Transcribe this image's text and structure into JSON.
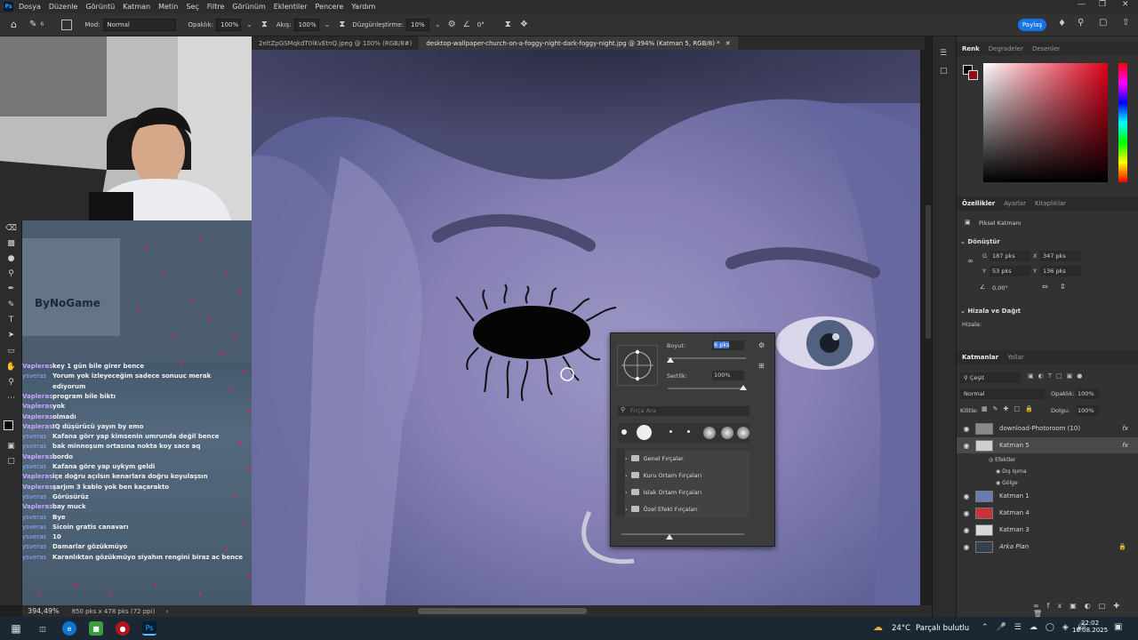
{
  "menu": {
    "app_logo": "Ps",
    "items": [
      "Dosya",
      "Düzenle",
      "Görüntü",
      "Katman",
      "Metin",
      "Seç",
      "Filtre",
      "Görünüm",
      "Eklentiler",
      "Pencere",
      "Yardım"
    ]
  },
  "options_bar": {
    "brush_size": "6",
    "mode_label": "Mod:",
    "mode_value": "Normal",
    "opacity_label": "Opaklık:",
    "opacity_value": "100%",
    "flow_label": "Akış:",
    "flow_value": "100%",
    "smoothing_label": "Düzgünleştirme:",
    "smoothing_value": "10%",
    "angle_value": "0°",
    "share_label": "Paylaş"
  },
  "tabs": [
    {
      "label": "2eltZpGSMqkdT0lKvEtnQ.jpeg @ 100% (RGB/8#)"
    },
    {
      "label": "desktop-wallpaper-church-on-a-foggy-night-dark-foggy-night.jpg @ 394% (Katman 5, RGB/8) *"
    }
  ],
  "overlay": {
    "watermark": "ByNoGame"
  },
  "chat": [
    {
      "user": "Vaplerаs",
      "text": "key 1 gün bile girer bence",
      "v": true
    },
    {
      "user": "ysverаs",
      "text": "Yorum yok izleyeceğim sadece sonuuc merak",
      "v": false
    },
    {
      "user": "",
      "text": "ediyorum",
      "v": false
    },
    {
      "user": "Vaplerаs",
      "text": "program bile biktı",
      "v": true
    },
    {
      "user": "Vaplerаs",
      "text": "yok",
      "v": true
    },
    {
      "user": "Vaplerаs",
      "text": "olmadı",
      "v": true
    },
    {
      "user": "Vaplerаs",
      "text": "IQ düşürücü yayın by emo",
      "v": true
    },
    {
      "user": "ysverаs",
      "text": "Kafana görr yap kimsenin umrunda değil bence",
      "v": false
    },
    {
      "user": "ysverаs",
      "text": "bak minnoşum ortasına nokta koy sace aq",
      "v": false
    },
    {
      "user": "Vaplerаs",
      "text": "bordo",
      "v": true
    },
    {
      "user": "ysverаs",
      "text": "Kafana göre yap uykym geldi",
      "v": false
    },
    {
      "user": "Vaplerаs",
      "text": "içe doğru açılsın kenarlara doğru koyulaşsın",
      "v": true
    },
    {
      "user": "Vaplerаs",
      "text": "şarjım 3 kablo yok ben kaçarakto",
      "v": true
    },
    {
      "user": "ysverаs",
      "text": "Görüsürüz",
      "v": false
    },
    {
      "user": "Vaplerаs",
      "text": "bay muck",
      "v": true
    },
    {
      "user": "ysverаs",
      "text": "Bye",
      "v": false
    },
    {
      "user": "ysverаs",
      "text": "Sicoin gratis canavarı",
      "v": false
    },
    {
      "user": "ysverаs",
      "text": "10",
      "v": false
    },
    {
      "user": "ysverаs",
      "text": "Damarlar gözükmüyo",
      "v": false
    },
    {
      "user": "ysverаs",
      "text": "Karanlıktan gözükmüyo siyahın rengini biraz ac bence",
      "v": false
    }
  ],
  "status": {
    "zoom": "394,49%",
    "doc_info": "850 pks x 478 pks (72 ppi)"
  },
  "brush_popup": {
    "size_label": "Boyut:",
    "size_value": "6 pks",
    "hardness_label": "Sertlik:",
    "hardness_value": "100%",
    "search_placeholder": "Fırça Ara",
    "folders": [
      "Genel Fırçalar",
      "Kuru Ortam Fırçaları",
      "Islak Ortam Fırçaları",
      "Özel Efekt Fırçaları"
    ]
  },
  "color_panel": {
    "tabs": [
      "Renk",
      "Degradeler",
      "Desenler"
    ],
    "hue_color": "#e0001a"
  },
  "properties_panel": {
    "tabs": [
      "Özellikler",
      "Ayarlar",
      "Kitaplıklar"
    ],
    "layer_type": "Piksel Katmanı",
    "transform_title": "Dönüştür",
    "w_label": "G",
    "w_value": "187 pks",
    "x_label": "X",
    "x_value": "347 pks",
    "h_label": "Y",
    "h_value": "53 pks",
    "y_label": "Y",
    "y_value": "136 pks",
    "angle_value": "0,00°",
    "align_title": "Hizala ve Dağıt",
    "align_label": "Hizala:"
  },
  "layers_panel": {
    "tabs": [
      "Katmanlar",
      "Yollar"
    ],
    "filter_label": "Çeşit",
    "blend_mode": "Normal",
    "opacity_label": "Opaklık:",
    "opacity_value": "100%",
    "lock_label": "Kilitle:",
    "fill_label": "Dolgu:",
    "fill_value": "100%",
    "layers": [
      {
        "name": "download-Photoroom (10)",
        "fx": "fx",
        "selected": false,
        "thumb": "#8a8a8a"
      },
      {
        "name": "Katman 5",
        "fx": "fx",
        "selected": true,
        "thumb": "#cfcfcf"
      },
      {
        "name": "Katman 1",
        "fx": "",
        "selected": false,
        "thumb": "#6c7ab4"
      },
      {
        "name": "Katman 4",
        "fx": "",
        "selected": false,
        "thumb": "#c8323a"
      },
      {
        "name": "Katman 3",
        "fx": "",
        "selected": false,
        "thumb": "#d8d8d8"
      },
      {
        "name": "Arka Plan",
        "fx": "",
        "selected": false,
        "thumb": "#34404c"
      }
    ],
    "effects_label": "Efektler",
    "effect1": "Dış Işıma",
    "effect2": "Gölge"
  },
  "taskbar": {
    "weather_temp": "24°C",
    "weather_text": "Parçalı bulutlu",
    "time": "22:02",
    "date": "10.08.2025"
  }
}
